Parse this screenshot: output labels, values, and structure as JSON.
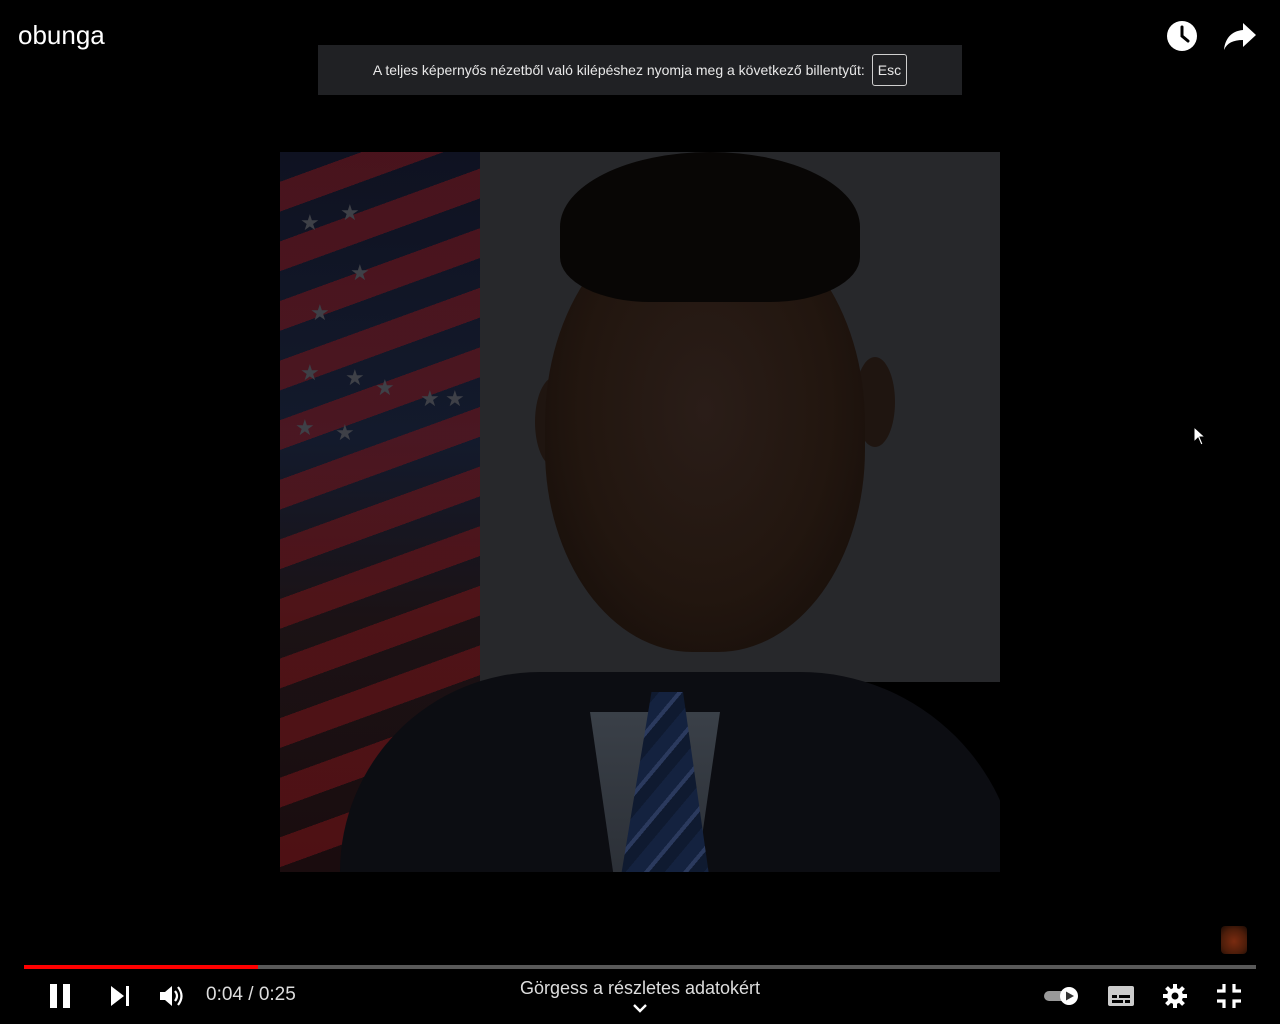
{
  "header": {
    "title": "obunga",
    "watch_later_icon": "clock-icon",
    "share_icon": "share-arrow-icon"
  },
  "fullscreen_notice": {
    "text": "A teljes képernyős nézetből való kilépéshez nyomja meg a következő billentyűt:",
    "key": "Esc"
  },
  "player": {
    "current_time": "0:04",
    "duration": "0:25",
    "time_display": "0:04 / 0:25",
    "progress_fraction": 0.19,
    "scroll_hint": "Görgess a részletes adatokért",
    "accent_color": "#ff0000"
  },
  "controls": {
    "play_pause_icon": "pause-icon",
    "next_icon": "next-icon",
    "volume_icon": "volume-icon",
    "autoplay_icon": "autoplay-toggle-icon",
    "subtitles_icon": "subtitles-icon",
    "settings_icon": "gear-icon",
    "exit_fullscreen_icon": "exit-fullscreen-icon"
  }
}
